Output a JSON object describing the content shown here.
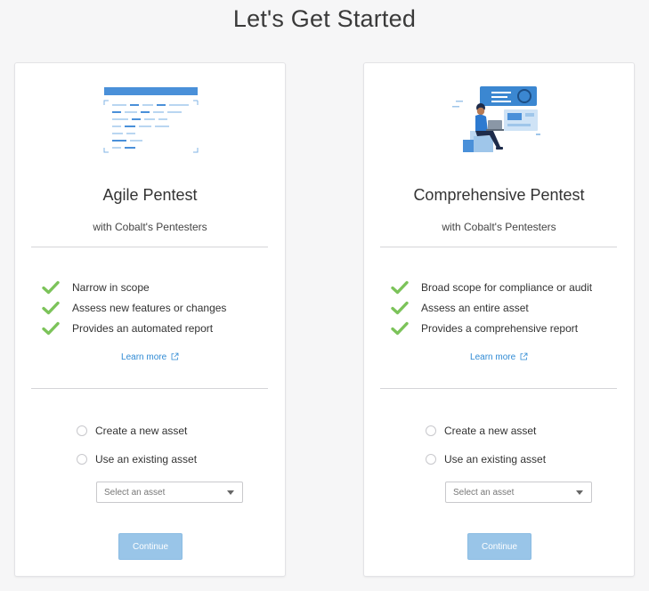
{
  "page": {
    "title": "Let's Get Started"
  },
  "cards": [
    {
      "title": "Agile Pentest",
      "subtitle": "with Cobalt's Pentesters",
      "features": [
        "Narrow in scope",
        "Assess new features or changes",
        "Provides an automated report"
      ],
      "learn_more": "Learn more",
      "options": [
        "Create a new asset",
        "Use an existing asset"
      ],
      "select_placeholder": "Select an asset",
      "button": "Continue"
    },
    {
      "title": "Comprehensive Pentest",
      "subtitle": "with Cobalt's Pentesters",
      "features": [
        "Broad scope for compliance or audit",
        "Assess an entire asset",
        "Provides a comprehensive report"
      ],
      "learn_more": "Learn more",
      "options": [
        "Create a new asset",
        "Use an existing asset"
      ],
      "select_placeholder": "Select an asset",
      "button": "Continue"
    }
  ],
  "icons": {
    "check": "check-icon",
    "external_link": "external-link-icon",
    "dropdown": "chevron-down-icon"
  },
  "colors": {
    "accent": "#2f8ad4",
    "check_green": "#7cc35a",
    "button_disabled": "#99c5e8"
  }
}
